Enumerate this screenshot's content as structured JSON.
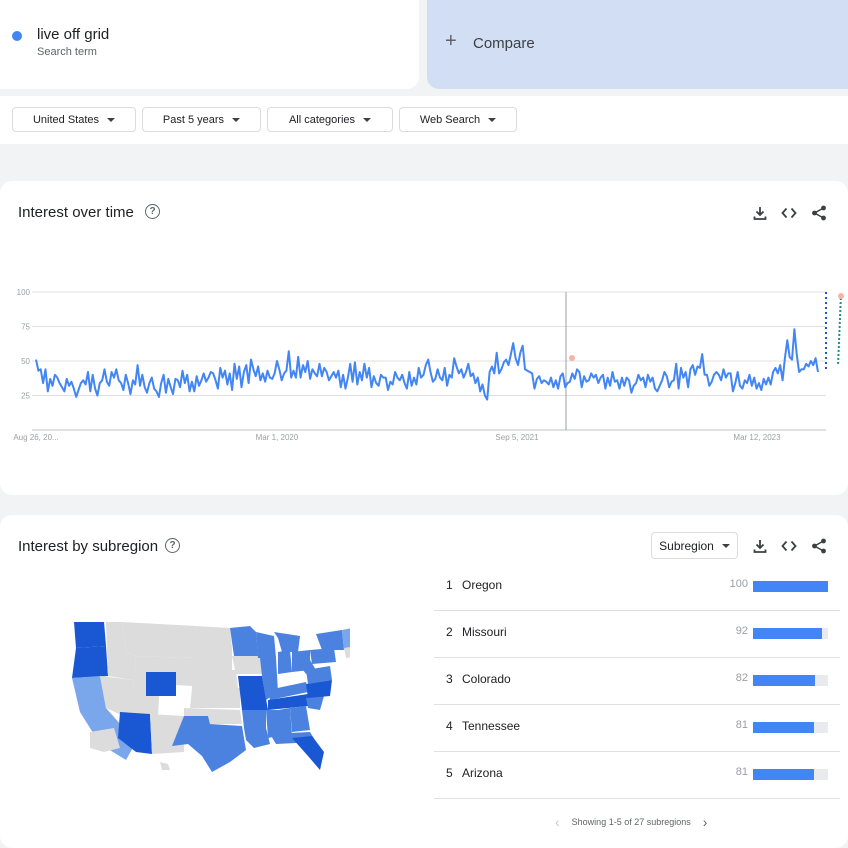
{
  "search_term": {
    "name": "live off grid",
    "subtitle": "Search term",
    "color": "#4285f4"
  },
  "compare": {
    "label": "Compare"
  },
  "filters": [
    {
      "label": "United States"
    },
    {
      "label": "Past 5 years"
    },
    {
      "label": "All categories"
    },
    {
      "label": "Web Search"
    }
  ],
  "interest_over_time": {
    "title": "Interest over time",
    "icons": [
      "download-icon",
      "embed-code-icon",
      "share-icon"
    ]
  },
  "chart_data": {
    "type": "line",
    "yticks": [
      100,
      75,
      50,
      25
    ],
    "ylim": [
      0,
      100
    ],
    "xtick_labels": [
      "Aug 26, 20...",
      "Mar 1, 2020",
      "Sep 5, 2021",
      "Mar 12, 2023"
    ],
    "series": [
      {
        "color": "#4285f4",
        "values": [
          51,
          43,
          44,
          34,
          44,
          28,
          37,
          32,
          40,
          38,
          34,
          31,
          28,
          37,
          32,
          35,
          30,
          24,
          29,
          34,
          36,
          33,
          42,
          28,
          40,
          30,
          25,
          34,
          36,
          44,
          35,
          32,
          42,
          38,
          44,
          36,
          34,
          29,
          40,
          34,
          26,
          36,
          33,
          47,
          32,
          40,
          31,
          27,
          34,
          38,
          30,
          28,
          24,
          34,
          40,
          27,
          37,
          31,
          26,
          37,
          36,
          31,
          43,
          34,
          40,
          28,
          35,
          28,
          39,
          32,
          36,
          41,
          35,
          38,
          42,
          41,
          36,
          30,
          45,
          38,
          43,
          33,
          41,
          29,
          48,
          37,
          46,
          31,
          42,
          47,
          34,
          51,
          44,
          39,
          46,
          36,
          41,
          35,
          43,
          38,
          37,
          41,
          50,
          44,
          36,
          41,
          43,
          57,
          38,
          43,
          38,
          53,
          38,
          47,
          42,
          50,
          37,
          44,
          41,
          39,
          48,
          39,
          45,
          42,
          36,
          39,
          42,
          38,
          43,
          31,
          40,
          30,
          38,
          48,
          35,
          49,
          33,
          42,
          36,
          48,
          38,
          45,
          31,
          39,
          34,
          32,
          40,
          38,
          38,
          29,
          35,
          33,
          42,
          38,
          36,
          40,
          34,
          30,
          42,
          32,
          38,
          33,
          45,
          38,
          40,
          47,
          51,
          42,
          35,
          37,
          44,
          38,
          36,
          45,
          32,
          40,
          38,
          52,
          46,
          41,
          44,
          38,
          42,
          48,
          39,
          41,
          34,
          38,
          28,
          33,
          25,
          22,
          42,
          46,
          41,
          56,
          41,
          44,
          49,
          51,
          47,
          55,
          63,
          52,
          47,
          56,
          61,
          44,
          43,
          42,
          41,
          30,
          37,
          39,
          34,
          36,
          35,
          33,
          38,
          31,
          36,
          30,
          39,
          41,
          31,
          34,
          35,
          41,
          37,
          44,
          42,
          31,
          39,
          35,
          36,
          41,
          38,
          40,
          34,
          38,
          40,
          30,
          38,
          32,
          42,
          35,
          36,
          30,
          38,
          32,
          38,
          36,
          27,
          32,
          34,
          40,
          36,
          38,
          31,
          40,
          35,
          38,
          30,
          28,
          32,
          36,
          42,
          39,
          31,
          35,
          36,
          48,
          30,
          45,
          38,
          42,
          31,
          44,
          47,
          40,
          46,
          45,
          55,
          40,
          40,
          32,
          35,
          40,
          42,
          40,
          36,
          44,
          38,
          41,
          41,
          28,
          34,
          42,
          32,
          30,
          36,
          34,
          40,
          32,
          38,
          30,
          34,
          29,
          37,
          33,
          38,
          33,
          42,
          45,
          41,
          47,
          36,
          52,
          65,
          53,
          51,
          73,
          55,
          42,
          44,
          44,
          48,
          46,
          50,
          47,
          52,
          42
        ]
      }
    ],
    "grid": true
  },
  "interest_by_subregion": {
    "title": "Interest by subregion",
    "select_label": "Subregion",
    "items": [
      {
        "rank": "1",
        "name": "Oregon",
        "value": 100
      },
      {
        "rank": "2",
        "name": "Missouri",
        "value": 92
      },
      {
        "rank": "3",
        "name": "Colorado",
        "value": 82
      },
      {
        "rank": "4",
        "name": "Tennessee",
        "value": 81
      },
      {
        "rank": "5",
        "name": "Arizona",
        "value": 81
      }
    ],
    "pager_text": "Showing 1-5 of 27 subregions",
    "map_colors": {
      "high": "#1a57d2",
      "mid": "#4b82e0",
      "low": "#7aa6ec",
      "none": "#dcdcdc"
    }
  }
}
